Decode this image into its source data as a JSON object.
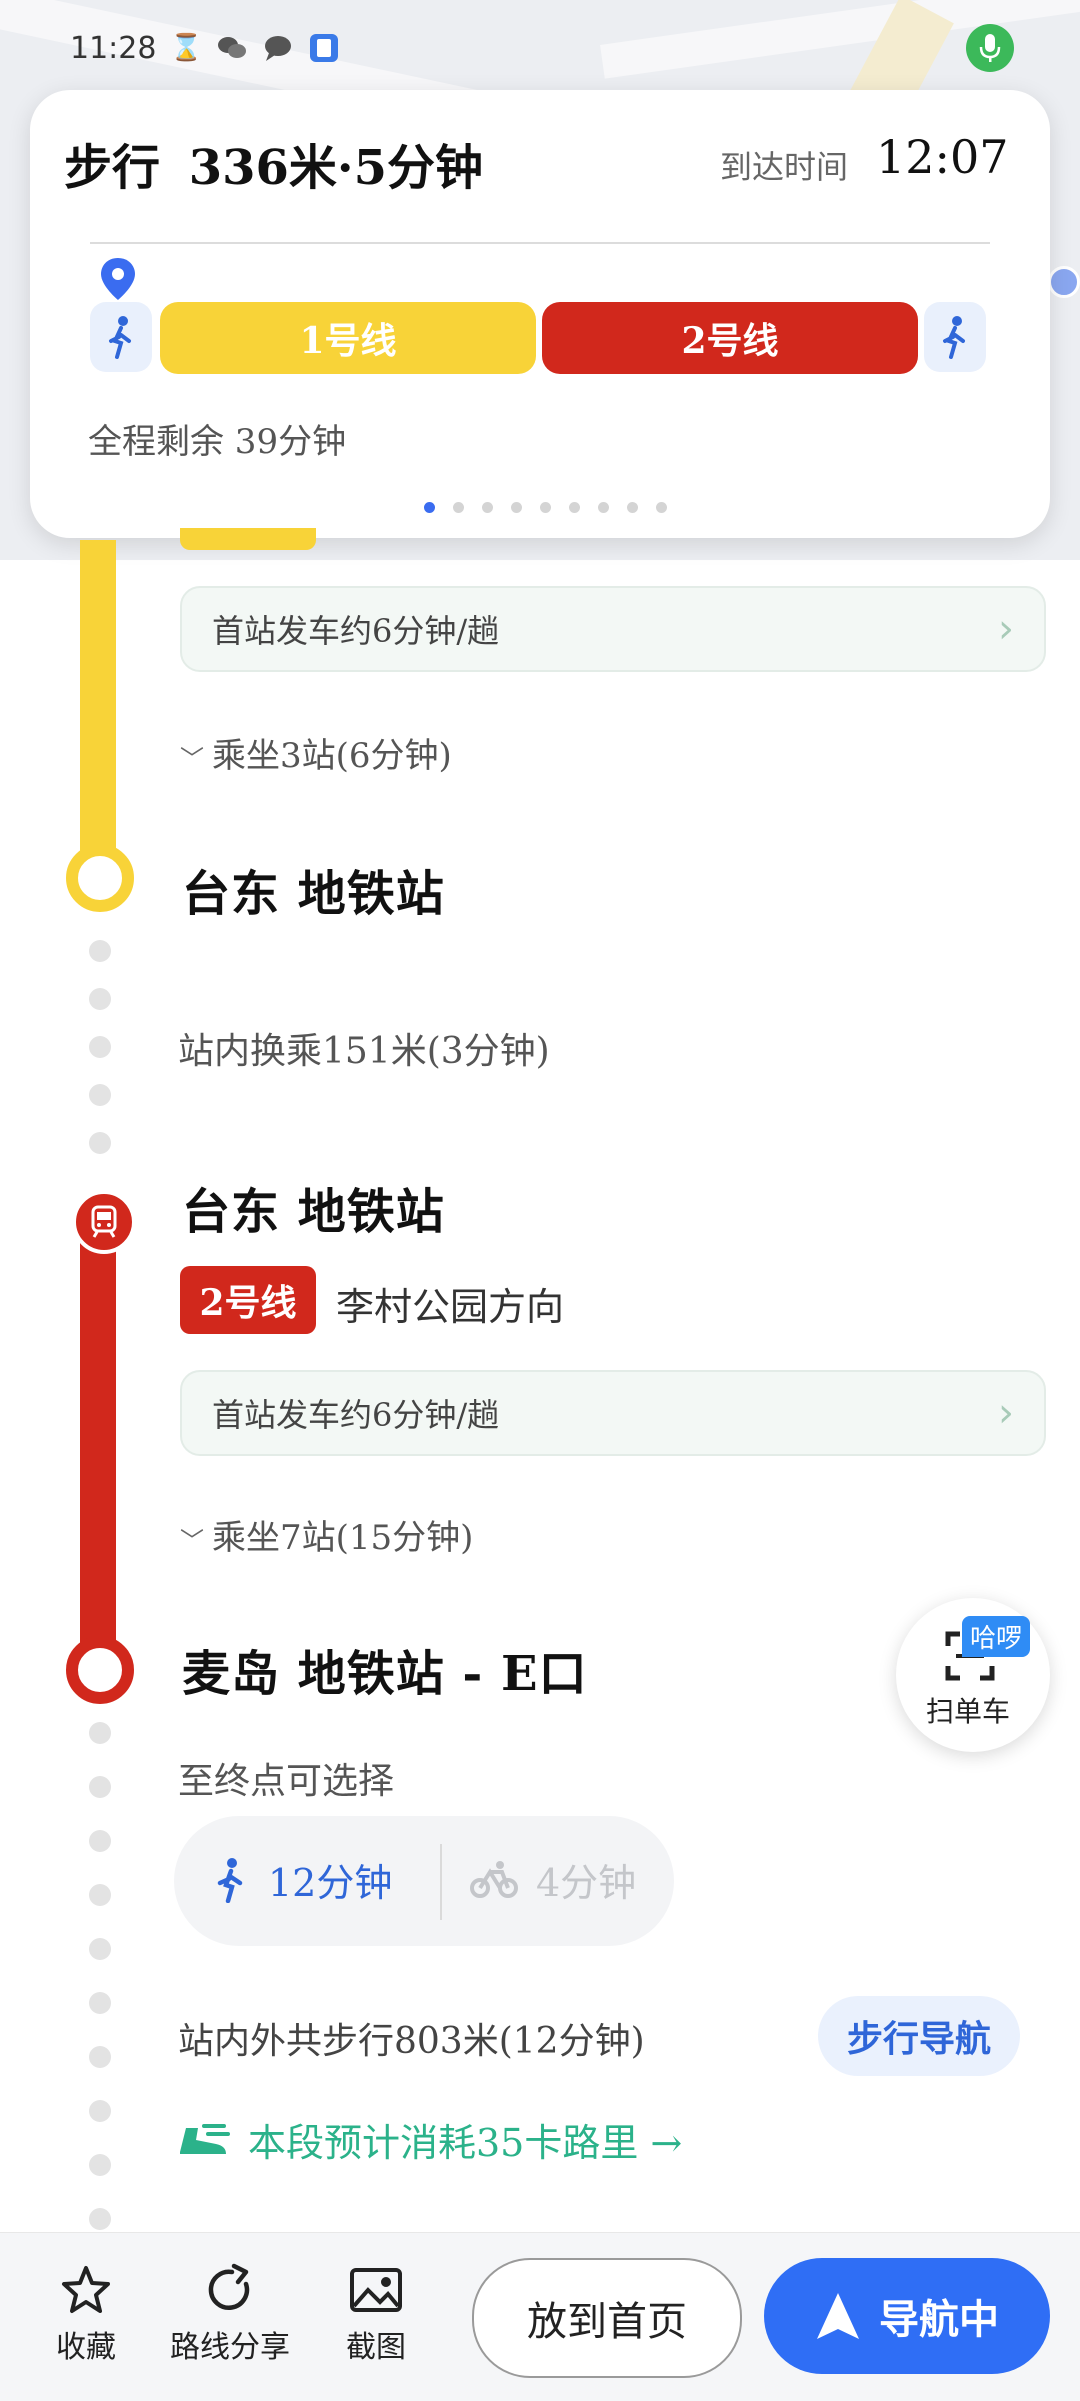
{
  "status_bar": {
    "time": "11:28"
  },
  "summary": {
    "mode": "步行",
    "distance_time": "336米·5分钟",
    "arrive_label": "到达时间",
    "arrive_time": "12:07",
    "segments": [
      {
        "label": "1号线",
        "color": "#f8d338"
      },
      {
        "label": "2号线",
        "color": "#d1281c"
      }
    ],
    "remaining": "全程剩余 39分钟",
    "page_count": 9,
    "active_page": 1
  },
  "leg1": {
    "frequency": "首站发车约6分钟/趟",
    "ride": "乘坐3站(6分钟)",
    "end_station": "台东 地铁站"
  },
  "transfer": {
    "text": "站内换乘151米(3分钟)"
  },
  "leg2": {
    "station": "台东 地铁站",
    "line_badge": "2号线",
    "direction": "李村公园方向",
    "frequency": "首站发车约6分钟/趟",
    "ride": "乘坐7站(15分钟)",
    "end_station": "麦岛 地铁站 - E口"
  },
  "last_mile": {
    "choose_label": "至终点可选择",
    "walk_time": "12分钟",
    "bike_time": "4分钟",
    "walk_total": "站内外共步行803米(12分钟)",
    "walk_nav_button": "步行导航",
    "calories": "本段预计消耗35卡路里 →"
  },
  "scan_bike": {
    "badge": "哈啰",
    "label": "扫单车"
  },
  "bottom_bar": {
    "favorite": "收藏",
    "share": "路线分享",
    "screenshot": "截图",
    "home_button": "放到首页",
    "nav_button": "导航中"
  },
  "colors": {
    "line1": "#f8d338",
    "line2": "#d1281c",
    "accent": "#2f6ef5",
    "green": "#2bb28a"
  }
}
